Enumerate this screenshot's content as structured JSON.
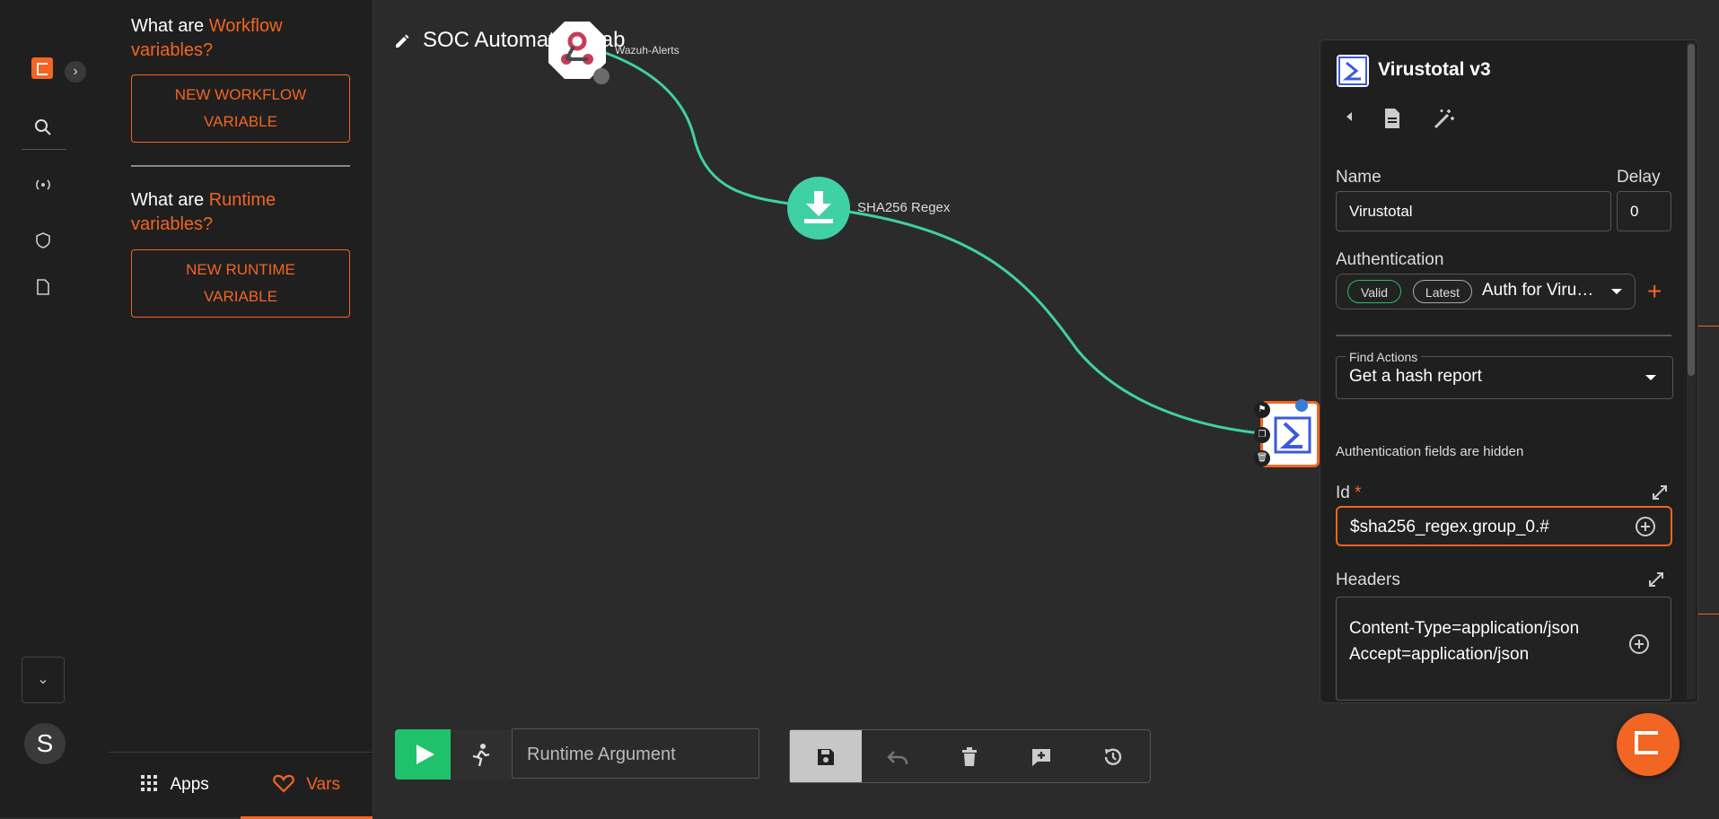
{
  "vars_panel": {
    "workflow_q_prefix": "What are ",
    "workflow_q_highlight": "Workflow",
    "workflow_q_suffix": "variables?",
    "new_workflow_btn_line1": "NEW WORKFLOW",
    "new_workflow_btn_line2": "VARIABLE",
    "runtime_q_prefix": "What are ",
    "runtime_q_highlight": "Runtime",
    "runtime_q_suffix": "variables?",
    "new_runtime_btn_line1": "NEW RUNTIME",
    "new_runtime_btn_line2": "VARIABLE",
    "tabs": [
      {
        "label": "Apps",
        "icon": "apps-grid-icon"
      },
      {
        "label": "Vars",
        "icon": "heart-icon",
        "active": true
      }
    ]
  },
  "rail": {
    "avatar_letter": "S",
    "icons": [
      "shuffle-logo",
      "expand-chevron-icon",
      "search-icon",
      "broadcast-icon",
      "shield-icon",
      "document-icon",
      "chevron-down-icon"
    ]
  },
  "workflow": {
    "title": "SOC Automation Lab",
    "nodes": [
      {
        "label": "Wazuh-Alerts",
        "icon": "webhook-icon"
      },
      {
        "label": "SHA256 Regex",
        "icon": "download-icon"
      },
      {
        "label": "",
        "icon": "virustotal-icon"
      }
    ]
  },
  "toolbar": {
    "runtime_placeholder": "Runtime Argument",
    "buttons": [
      "save-icon",
      "undo-icon",
      "delete-icon",
      "comment-icon",
      "history-icon"
    ]
  },
  "panel": {
    "app_title": "Virustotal v3",
    "name_label": "Name",
    "name_value": "Virustotal",
    "delay_label": "Delay",
    "delay_value": "0",
    "auth_label": "Authentication",
    "auth_valid": "Valid",
    "auth_latest": "Latest",
    "auth_value": "Auth for Viru…",
    "find_actions_label": "Find Actions",
    "find_actions_value": "Get a hash report",
    "auth_hidden_note": "Authentication fields are hidden",
    "id_label": "Id",
    "id_required": "*",
    "id_value": "$sha256_regex.group_0.#",
    "headers_label": "Headers",
    "headers_line1": "Content-Type=application/json",
    "headers_line2": "Accept=application/json"
  },
  "colors": {
    "accent": "#f26522",
    "edge": "#3fd1a4",
    "run": "#1fc16b",
    "valid": "#1fc16b"
  }
}
